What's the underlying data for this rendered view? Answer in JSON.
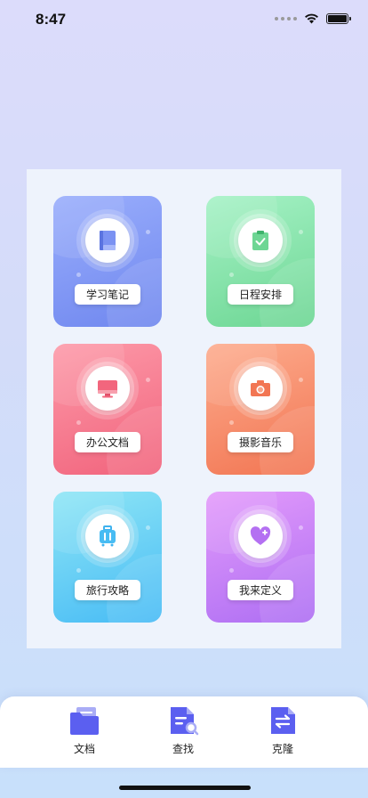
{
  "status_bar": {
    "time": "8:47",
    "icons": [
      "signal-dots-icon",
      "wifi-icon",
      "battery-icon"
    ]
  },
  "grid": {
    "cards": [
      {
        "label": "学习笔记",
        "icon": "notebook-icon",
        "color_top": "#9aaefc",
        "color_bottom": "#6f87ef"
      },
      {
        "label": "日程安排",
        "icon": "clipboard-check-icon",
        "color_top": "#a6f2c6",
        "color_bottom": "#6cd693"
      },
      {
        "label": "办公文档",
        "icon": "monitor-icon",
        "color_top": "#fd9aa9",
        "color_bottom": "#f1637c"
      },
      {
        "label": "摄影音乐",
        "icon": "camera-icon",
        "color_top": "#fdac8e",
        "color_bottom": "#f27552"
      },
      {
        "label": "旅行攻略",
        "icon": "suitcase-icon",
        "color_top": "#8fe6f5",
        "color_bottom": "#47bbf5"
      },
      {
        "label": "我来定义",
        "icon": "heart-plus-icon",
        "color_top": "#e49bfb",
        "color_bottom": "#ad6ef3"
      }
    ]
  },
  "tab_bar": {
    "tabs": [
      {
        "label": "文档",
        "icon": "folder-icon"
      },
      {
        "label": "查找",
        "icon": "document-search-icon"
      },
      {
        "label": "克隆",
        "icon": "document-transfer-icon"
      }
    ],
    "accent": "#5b5ff0"
  }
}
